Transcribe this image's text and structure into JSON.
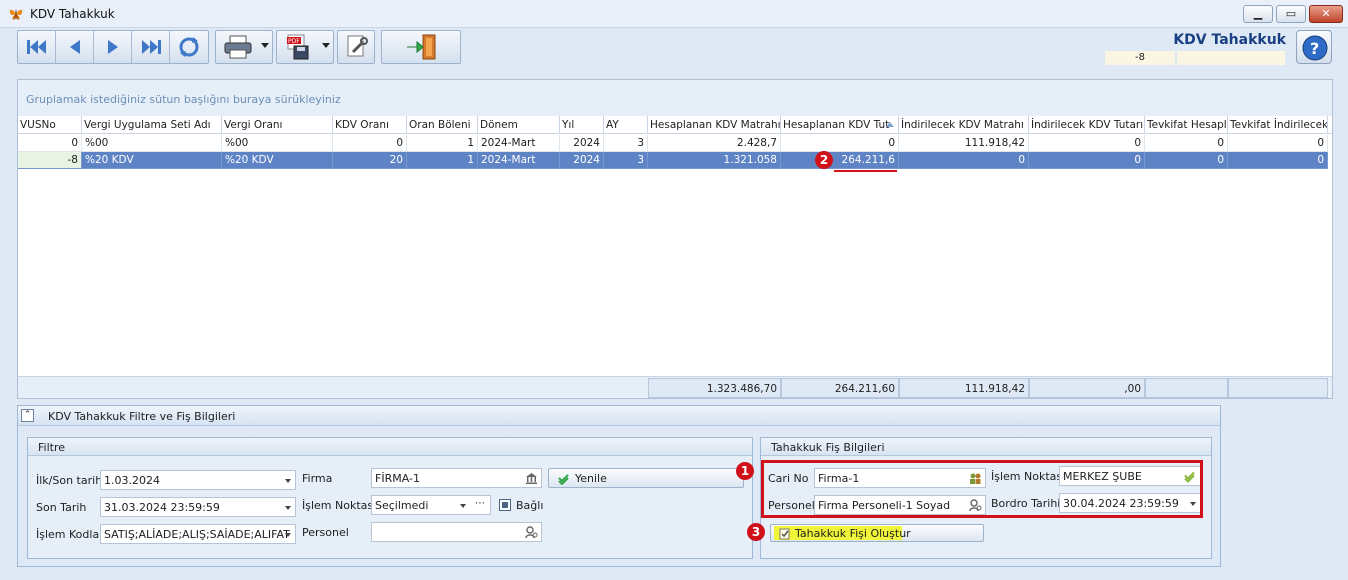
{
  "window": {
    "title": "KDV Tahakkuk"
  },
  "header": {
    "title": "KDV Tahakkuk",
    "field_value": "-8"
  },
  "toolbar": {
    "buttons": [
      "first-icon",
      "prev-icon",
      "next-icon",
      "last-icon",
      "refresh-icon",
      "print-icon",
      "pdf-icon",
      "settings-icon",
      "exit-icon"
    ]
  },
  "grid": {
    "group_hint": "Gruplamak istediğiniz sütun başlığını buraya sürükleyiniz",
    "columns": [
      "VUSNo",
      "Vergi Uygulama Seti Adı",
      "Vergi Oranı",
      "KDV Oranı",
      "Oran Böleni",
      "Dönem",
      "Yıl",
      "AY",
      "Hesaplanan KDV Matrahı",
      "Hesaplanan KDV Tut",
      "İndirilecek KDV Matrahı",
      "İndirilecek KDV Tutarı",
      "Tevkifat Hesapla",
      "Tevkifat İndirilecek"
    ],
    "rows": [
      [
        "0",
        "%00",
        "%00",
        "0",
        "1",
        "2024-Mart",
        "2024",
        "3",
        "2.428,7",
        "0",
        "111.918,42",
        "0",
        "0",
        "0"
      ],
      [
        "-8",
        "%20 KDV",
        "%20 KDV",
        "20",
        "1",
        "2024-Mart",
        "2024",
        "3",
        "1.321.058",
        "264.211,6",
        "0",
        "0",
        "0",
        "0"
      ]
    ],
    "totals": [
      "1.323.486,70",
      "264.211,60",
      "111.918,42",
      ",00",
      "",
      ""
    ]
  },
  "markers": [
    "1",
    "2",
    "3"
  ],
  "panel": {
    "title": "KDV Tahakkuk Filtre ve Fiş Bilgileri",
    "filter": {
      "title": "Filtre",
      "ilk_son_label": "İlk/Son tarih",
      "ilk_son_value": "1.03.2024",
      "son_tarih_label": "Son Tarih",
      "son_tarih_value": "31.03.2024 23:59:59",
      "islem_kodlari_label": "İşlem Kodları",
      "islem_kodlari_value": "SATIŞ;ALİADE;ALIŞ;SAİADE;ALIFAT",
      "firma_label": "Firma",
      "firma_value": "FİRMA-1",
      "islem_noktasi_label": "İşlem Noktası",
      "islem_noktasi_value": "Seçilmedi",
      "bagli_label": "Bağlı",
      "personel_label": "Personel",
      "personel_value": "",
      "yenile_label": "Yenile"
    },
    "fis": {
      "title": "Tahakkuk Fiş Bilgileri",
      "cari_no_label": "Cari No",
      "cari_no_value": "Firma-1",
      "personel_label": "Personel",
      "personel_value": "Firma Personeli-1 Soyad",
      "islem_noktasi_label": "İşlem Noktası",
      "islem_noktasi_value": "MERKEZ ŞUBE",
      "bordro_tarihi_label": "Bordro Tarihi",
      "bordro_tarihi_value": "30.04.2024 23:59:59",
      "olustur_label": "Tahakkuk Fişi Oluştur"
    }
  },
  "colors": {
    "accent": "#1a3f83",
    "selection": "#5f84c6",
    "marker": "#d0111a",
    "highlight": "#f1f53a"
  }
}
